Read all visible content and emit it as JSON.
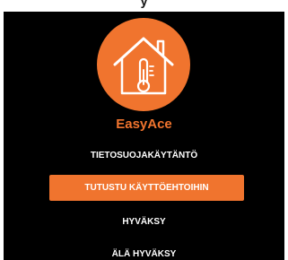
{
  "app": {
    "name": "EasyAce",
    "brand_color": "#f0742e",
    "background_color": "#000000",
    "logo_icon": "house-thermometer-icon"
  },
  "frame": {
    "top_text": "y"
  },
  "actions": {
    "privacy_label": "TIETOSUOJAKÄYTÄNTÖ",
    "terms_label": "TUTUSTU KÄYTTÖEHTOIHIN",
    "accept_label": "HYVÄKSY",
    "decline_label": "ÄLÄ HYVÄKSY"
  }
}
